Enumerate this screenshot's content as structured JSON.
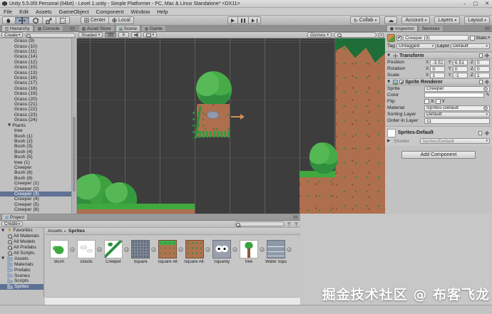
{
  "window": {
    "title": "Unity 5.5.0f3 Personal (64bit) - Level 1.unity - Simple Platformer - PC, Mac & Linux Standalone* <DX11>",
    "minimize": "–",
    "maximize": "□",
    "close": "✕"
  },
  "menubar": {
    "items": [
      "File",
      "Edit",
      "Assets",
      "GameObject",
      "Component",
      "Window",
      "Help"
    ]
  },
  "toolbar": {
    "center": "Center",
    "local": "Local",
    "collab": "Collab",
    "account": "Account",
    "layers": "Layers",
    "layout": "Layout"
  },
  "hierarchy": {
    "tab": "Hierarchy",
    "console_tab": "Console",
    "create": "Create",
    "items": [
      {
        "label": "Grass (9)",
        "indent": 2
      },
      {
        "label": "Grass (10)",
        "indent": 2
      },
      {
        "label": "Grass (11)",
        "indent": 2
      },
      {
        "label": "Grass (14)",
        "indent": 2
      },
      {
        "label": "Grass (12)",
        "indent": 2
      },
      {
        "label": "Grass (15)",
        "indent": 2
      },
      {
        "label": "Grass (13)",
        "indent": 2
      },
      {
        "label": "Grass (16)",
        "indent": 2
      },
      {
        "label": "Grass (17)",
        "indent": 2
      },
      {
        "label": "Grass (18)",
        "indent": 2
      },
      {
        "label": "Grass (19)",
        "indent": 2
      },
      {
        "label": "Grass (20)",
        "indent": 2
      },
      {
        "label": "Grass (21)",
        "indent": 2
      },
      {
        "label": "Grass (22)",
        "indent": 2
      },
      {
        "label": "Grass (23)",
        "indent": 2
      },
      {
        "label": "Grass (24)",
        "indent": 2
      },
      {
        "label": "Plants",
        "indent": 1,
        "fold": true
      },
      {
        "label": "tree",
        "indent": 2
      },
      {
        "label": "Bush (1)",
        "indent": 2
      },
      {
        "label": "Bush (2)",
        "indent": 2
      },
      {
        "label": "Bush (3)",
        "indent": 2
      },
      {
        "label": "Bush (4)",
        "indent": 2
      },
      {
        "label": "Bush (5)",
        "indent": 2
      },
      {
        "label": "tree (1)",
        "indent": 2
      },
      {
        "label": "Creeper",
        "indent": 2
      },
      {
        "label": "Bush (6)",
        "indent": 2
      },
      {
        "label": "Bush (8)",
        "indent": 2
      },
      {
        "label": "Creeper (1)",
        "indent": 2
      },
      {
        "label": "Creeper (2)",
        "indent": 2
      },
      {
        "label": "Creeper (3)",
        "indent": 2,
        "selected": true
      },
      {
        "label": "Creeper (4)",
        "indent": 2
      },
      {
        "label": "Creeper (5)",
        "indent": 2
      },
      {
        "label": "Creeper (6)",
        "indent": 2
      }
    ]
  },
  "scene": {
    "asset_store_tab": "Asset Store",
    "scene_tab": "Scene",
    "game_tab": "Game",
    "shaded": "Shaded",
    "mode_2d": "2D",
    "gizmos": "Gizmos"
  },
  "inspector": {
    "tab": "Inspector",
    "services_tab": "Services",
    "object_name": "Creeper (3)",
    "static_label": "Static",
    "tag_label": "Tag",
    "tag_value": "Untagged",
    "layer_label": "Layer",
    "layer_value": "Default",
    "transform": {
      "title": "Transform",
      "axis_x": "X",
      "axis_y": "Y",
      "axis_z": "Z",
      "rows": [
        {
          "label": "Position",
          "x": "-3.51",
          "y": "6.51",
          "z": "0"
        },
        {
          "label": "Rotation",
          "x": "0",
          "y": "0",
          "z": "0"
        },
        {
          "label": "Scale",
          "x": "1",
          "y": "-1",
          "z": "1"
        }
      ]
    },
    "sprite_renderer": {
      "title": "Sprite Renderer",
      "sprite_label": "Sprite",
      "sprite_value": "Creeper",
      "color_label": "Color",
      "flip_label": "Flip",
      "flip_x": "X",
      "flip_y": "Y",
      "material_label": "Material",
      "material_value": "Sprites-Default",
      "sorting_layer_label": "Sorting Layer",
      "sorting_layer_value": "Default",
      "order_label": "Order in Layer",
      "order_value": "11"
    },
    "material": {
      "name": "Sprites-Default",
      "shader_label": "Shader",
      "shader_value": "Sprites/Default"
    },
    "add_component": "Add Component"
  },
  "project": {
    "tab": "Project",
    "create": "Create",
    "breadcrumb_root": "Assets",
    "breadcrumb_sep": "▸",
    "breadcrumb_current": "Sprites",
    "tree": [
      {
        "label": "Favorites",
        "indent": 0,
        "fold": true,
        "icon": "star"
      },
      {
        "label": "All Materials",
        "indent": 1,
        "icon": "search"
      },
      {
        "label": "All Models",
        "indent": 1,
        "icon": "search"
      },
      {
        "label": "All Prefabs",
        "indent": 1,
        "icon": "search"
      },
      {
        "label": "All Scripts",
        "indent": 1,
        "icon": "search"
      },
      {
        "label": "Assets",
        "indent": 0,
        "fold": true,
        "icon": "folder"
      },
      {
        "label": "Materials",
        "indent": 1,
        "icon": "folder"
      },
      {
        "label": "Prefabs",
        "indent": 1,
        "icon": "folder"
      },
      {
        "label": "Scenes",
        "indent": 1,
        "icon": "folder"
      },
      {
        "label": "Scripts",
        "indent": 1,
        "icon": "folder"
      },
      {
        "label": "Sprites",
        "indent": 1,
        "icon": "folder",
        "selected": true
      }
    ],
    "thumbnails": [
      {
        "label": "Bush",
        "type": "bush"
      },
      {
        "label": "clouds",
        "type": "clouds"
      },
      {
        "label": "Creeper",
        "type": "creeper"
      },
      {
        "label": "Square",
        "type": "square"
      },
      {
        "label": "Square Alt",
        "type": "squarealt"
      },
      {
        "label": "Square Alt 2",
        "type": "squarealt2"
      },
      {
        "label": "Squarey",
        "type": "squarey"
      },
      {
        "label": "tree",
        "type": "tree"
      },
      {
        "label": "Water Squa...",
        "type": "water"
      }
    ]
  },
  "watermark": "掘金技术社区 @ 布客飞龙",
  "colors": {
    "selection": "#5f7293",
    "scene_background": "#3d3d3d",
    "dirt": "#ae6f4e",
    "grass": "#3fa83f",
    "chrome": "#c6c6c6"
  }
}
